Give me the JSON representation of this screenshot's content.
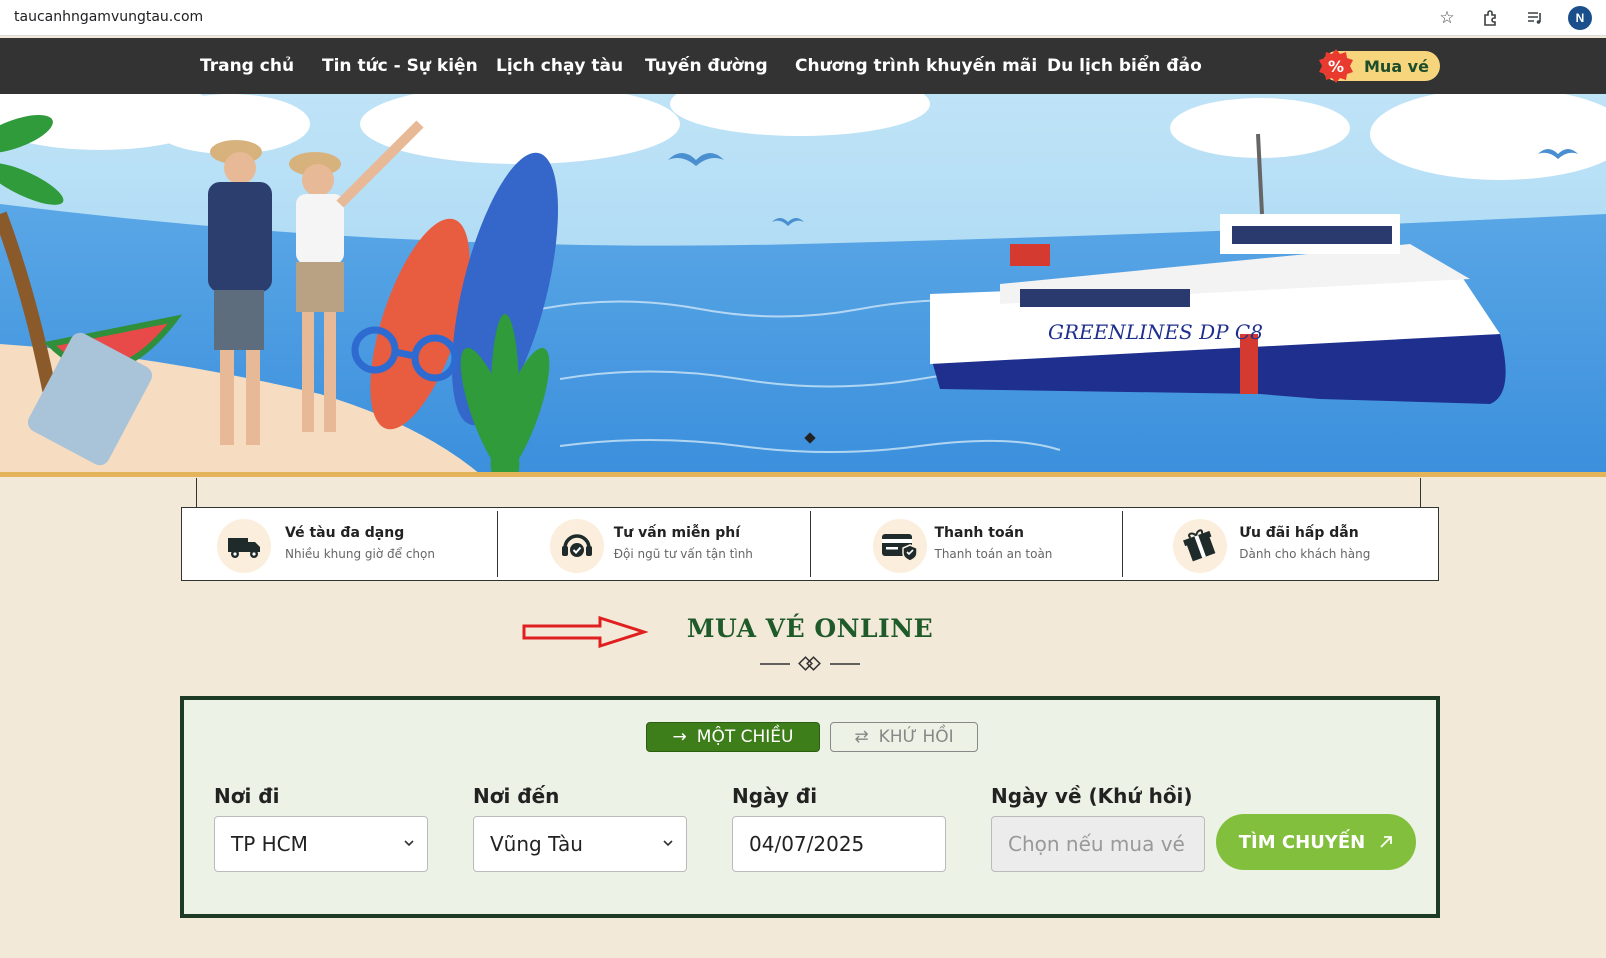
{
  "browser": {
    "url": "taucanhngamvungtau.com",
    "avatar_initial": "N",
    "icons": [
      "star-icon",
      "extension-icon",
      "media-control-icon",
      "profile-avatar"
    ]
  },
  "nav": {
    "items": [
      {
        "label": "Trang chủ"
      },
      {
        "label": "Tin tức - Sự kiện"
      },
      {
        "label": "Lịch chạy tàu"
      },
      {
        "label": "Tuyến đường"
      },
      {
        "label": "Chương trình khuyến mãi"
      },
      {
        "label": "Du lịch biển đảo"
      }
    ],
    "buy_button": {
      "label": "Mua vé",
      "badge": "%"
    }
  },
  "banner": {
    "ship_text": "GREENLINES DP C8"
  },
  "features": [
    {
      "title": "Vé tàu đa dạng",
      "subtitle": "Nhiều khung giờ để chọn",
      "icon": "truck-icon"
    },
    {
      "title": "Tư vấn miễn phí",
      "subtitle": "Đội ngũ tư vấn tận tình",
      "icon": "headset-icon"
    },
    {
      "title": "Thanh toán",
      "subtitle": "Thanh toán an toàn",
      "icon": "card-payment-icon"
    },
    {
      "title": "Ưu đãi hấp dẫn",
      "subtitle": "Dành cho khách hàng",
      "icon": "gift-icon"
    }
  ],
  "section": {
    "title": "MUA VÉ ONLINE"
  },
  "booking": {
    "tabs": {
      "one_way": "MỘT CHIỀU",
      "round_trip": "KHỨ HỒI",
      "selected": "one_way"
    },
    "from": {
      "label": "Nơi đi",
      "value": "TP HCM"
    },
    "to": {
      "label": "Nơi đến",
      "value": "Vũng Tàu"
    },
    "depart": {
      "label": "Ngày đi",
      "value": "04/07/2025"
    },
    "return": {
      "label": "Ngày về (Khứ hồi)",
      "placeholder": "Chọn nếu mua vé"
    },
    "search_button": "TÌM CHUYẾN"
  },
  "colors": {
    "nav_bg": "#333333",
    "accent_green": "#3e7e1a",
    "search_green": "#82bf3c",
    "title_green": "#1e5a2a",
    "page_bg": "#f3e9d8",
    "buy_yellow": "#f6d57c"
  }
}
